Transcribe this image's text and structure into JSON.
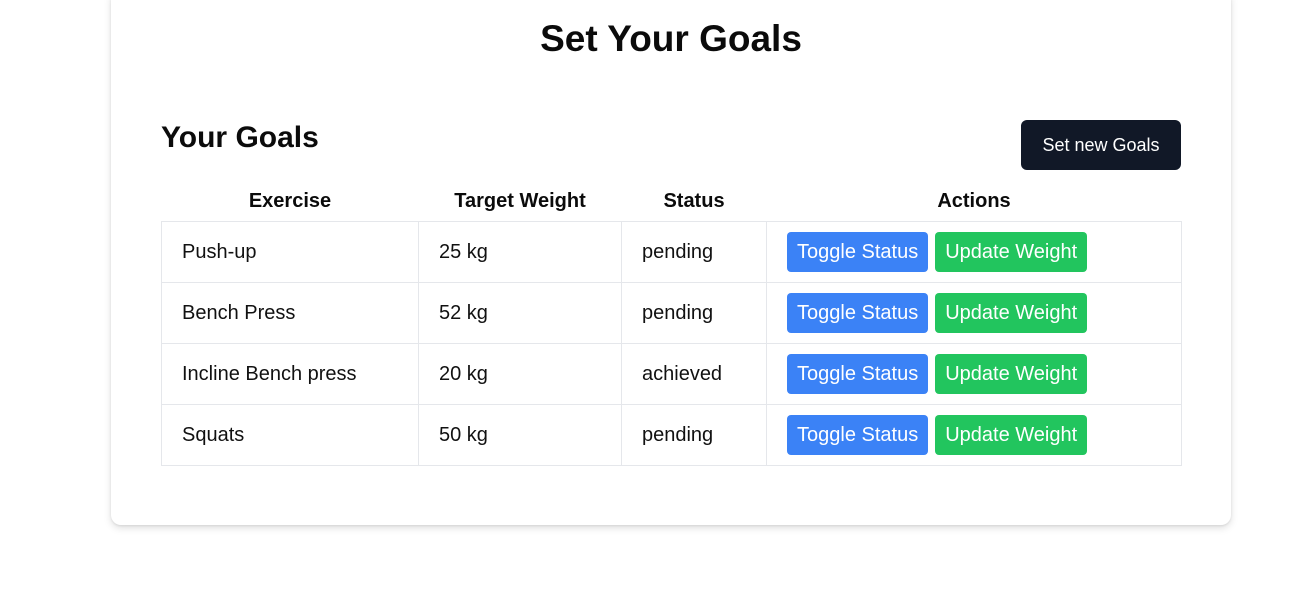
{
  "page": {
    "title": "Set Your Goals"
  },
  "goals_section": {
    "title": "Your Goals",
    "new_goals_button": "Set new Goals"
  },
  "table": {
    "headers": [
      "Exercise",
      "Target Weight",
      "Status",
      "Actions"
    ],
    "rows": [
      {
        "exercise": "Push-up",
        "target_weight": "25 kg",
        "status": "pending",
        "toggle_label": "Toggle Status",
        "update_label": "Update Weight"
      },
      {
        "exercise": "Bench Press",
        "target_weight": "52 kg",
        "status": "pending",
        "toggle_label": "Toggle Status",
        "update_label": "Update Weight"
      },
      {
        "exercise": "Incline Bench press",
        "target_weight": "20 kg",
        "status": "achieved",
        "toggle_label": "Toggle Status",
        "update_label": "Update Weight"
      },
      {
        "exercise": "Squats",
        "target_weight": "50 kg",
        "status": "pending",
        "toggle_label": "Toggle Status",
        "update_label": "Update Weight"
      }
    ]
  },
  "colors": {
    "primary_dark": "#111827",
    "toggle_blue": "#3b82f6",
    "update_green": "#22c55e",
    "border": "#e5e7eb"
  }
}
